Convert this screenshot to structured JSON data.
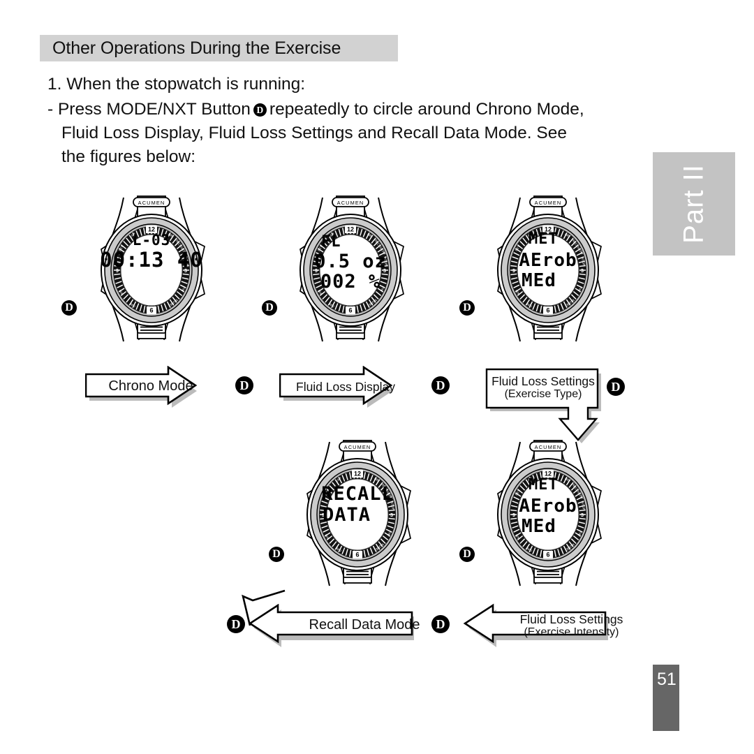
{
  "document": {
    "heading": "Other Operations During the Exercise",
    "part_label": "Part II",
    "page_number": "51"
  },
  "instructions": {
    "step_number": "1. When the stopwatch is running:",
    "bullet_prefix": "- Press MODE/NXT Button",
    "button_glyph": "D",
    "bullet_line1_rest": "repeatedly to circle around Chrono Mode,",
    "bullet_line2": "Fluid Loss Display, Fluid Loss Settings and Recall Data Mode. See",
    "bullet_line3": "the figures below:"
  },
  "watches": [
    {
      "id": "chrono-mode",
      "brand": "ACUMEN",
      "bezel_top": "12",
      "bezel_bottom": "6",
      "lcd_line1": "L-03",
      "lcd_line2": "00:13 40",
      "lcd_line3": "",
      "button_badge": "D"
    },
    {
      "id": "fluid-loss-display",
      "brand": "ACUMEN",
      "bezel_top": "12",
      "bezel_bottom": "6",
      "lcd_line1": "FL",
      "lcd_line2": "0.5 oz",
      "lcd_line3": "002 %",
      "button_badge": "D"
    },
    {
      "id": "fluid-loss-settings-type",
      "brand": "ACUMEN",
      "bezel_top": "12",
      "bezel_bottom": "6",
      "lcd_line1": "MET",
      "lcd_line2": "AErob",
      "lcd_line3": "MEd",
      "button_badge": "D"
    },
    {
      "id": "recall-data-mode",
      "brand": "ACUMEN",
      "bezel_top": "12",
      "bezel_bottom": "6",
      "lcd_line1": "RECALL",
      "lcd_line2": "DATA",
      "lcd_line3": "",
      "button_badge": "D"
    },
    {
      "id": "fluid-loss-settings-intensity",
      "brand": "ACUMEN",
      "bezel_top": "12",
      "bezel_bottom": "6",
      "lcd_line1": "MET",
      "lcd_line2": "AErob",
      "lcd_line3": "MEd",
      "button_badge": "D"
    }
  ],
  "flow_labels": [
    {
      "id": "chrono-mode",
      "line1": "Chrono Mode",
      "line2": "",
      "direction": "right"
    },
    {
      "id": "fluid-loss-display",
      "line1": "Fluid Loss Display",
      "line2": "",
      "direction": "right"
    },
    {
      "id": "fluid-loss-settings-type",
      "line1": "Fluid Loss Settings",
      "line2": "(Exercise Type)",
      "direction": "down"
    },
    {
      "id": "recall-data-mode",
      "line1": "Recall Data Mode",
      "line2": "",
      "direction": "left"
    },
    {
      "id": "fluid-loss-settings-intensity",
      "line1": "Fluid Loss Settings",
      "line2": "(Exercise Intensity)",
      "direction": "left"
    }
  ],
  "flow_badges": [
    {
      "id": "badge-1",
      "label": "D"
    },
    {
      "id": "badge-2",
      "label": "D"
    },
    {
      "id": "badge-3",
      "label": "D"
    },
    {
      "id": "badge-4",
      "label": "D"
    },
    {
      "id": "badge-5",
      "label": "D"
    }
  ],
  "colors": {
    "heading_band": "#d2d2d2",
    "part_tab": "#c3c3c3",
    "page_tab": "#666666",
    "bezel_outer": "#c9c9c9",
    "bezel_ring": "#1a1a1a",
    "lcd_face": "#ffffff",
    "ink": "#000000"
  }
}
